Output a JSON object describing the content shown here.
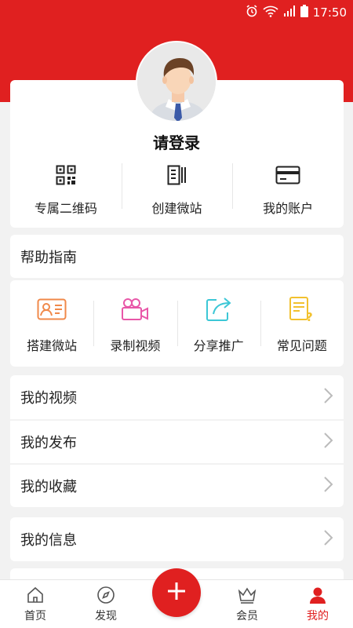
{
  "status_bar": {
    "time": "17:50"
  },
  "profile": {
    "login_text": "请登录"
  },
  "quick_actions": [
    {
      "label": "专属二维码",
      "icon": "qr-code-icon"
    },
    {
      "label": "创建微站",
      "icon": "site-icon"
    },
    {
      "label": "我的账户",
      "icon": "card-icon"
    }
  ],
  "help": {
    "title": "帮助指南",
    "items": [
      {
        "label": "搭建微站",
        "icon": "id-card-icon",
        "color": "#f0894a"
      },
      {
        "label": "录制视频",
        "icon": "video-camera-icon",
        "color": "#e857a8"
      },
      {
        "label": "分享推广",
        "icon": "share-icon",
        "color": "#3cc7d6"
      },
      {
        "label": "常见问题",
        "icon": "faq-icon",
        "color": "#f2c12e"
      }
    ]
  },
  "menu": {
    "group1": [
      "我的视频",
      "我的发布",
      "我的收藏"
    ],
    "group2": [
      "我的信息"
    ]
  },
  "tabbar": {
    "items": [
      {
        "label": "首页",
        "icon": "home-icon"
      },
      {
        "label": "发现",
        "icon": "compass-icon"
      },
      {
        "label": "会员",
        "icon": "crown-icon"
      },
      {
        "label": "我的",
        "icon": "user-icon",
        "active": true
      }
    ],
    "fab_icon": "plus-icon"
  },
  "colors": {
    "accent": "#e02020",
    "background": "#f2f2f2"
  }
}
